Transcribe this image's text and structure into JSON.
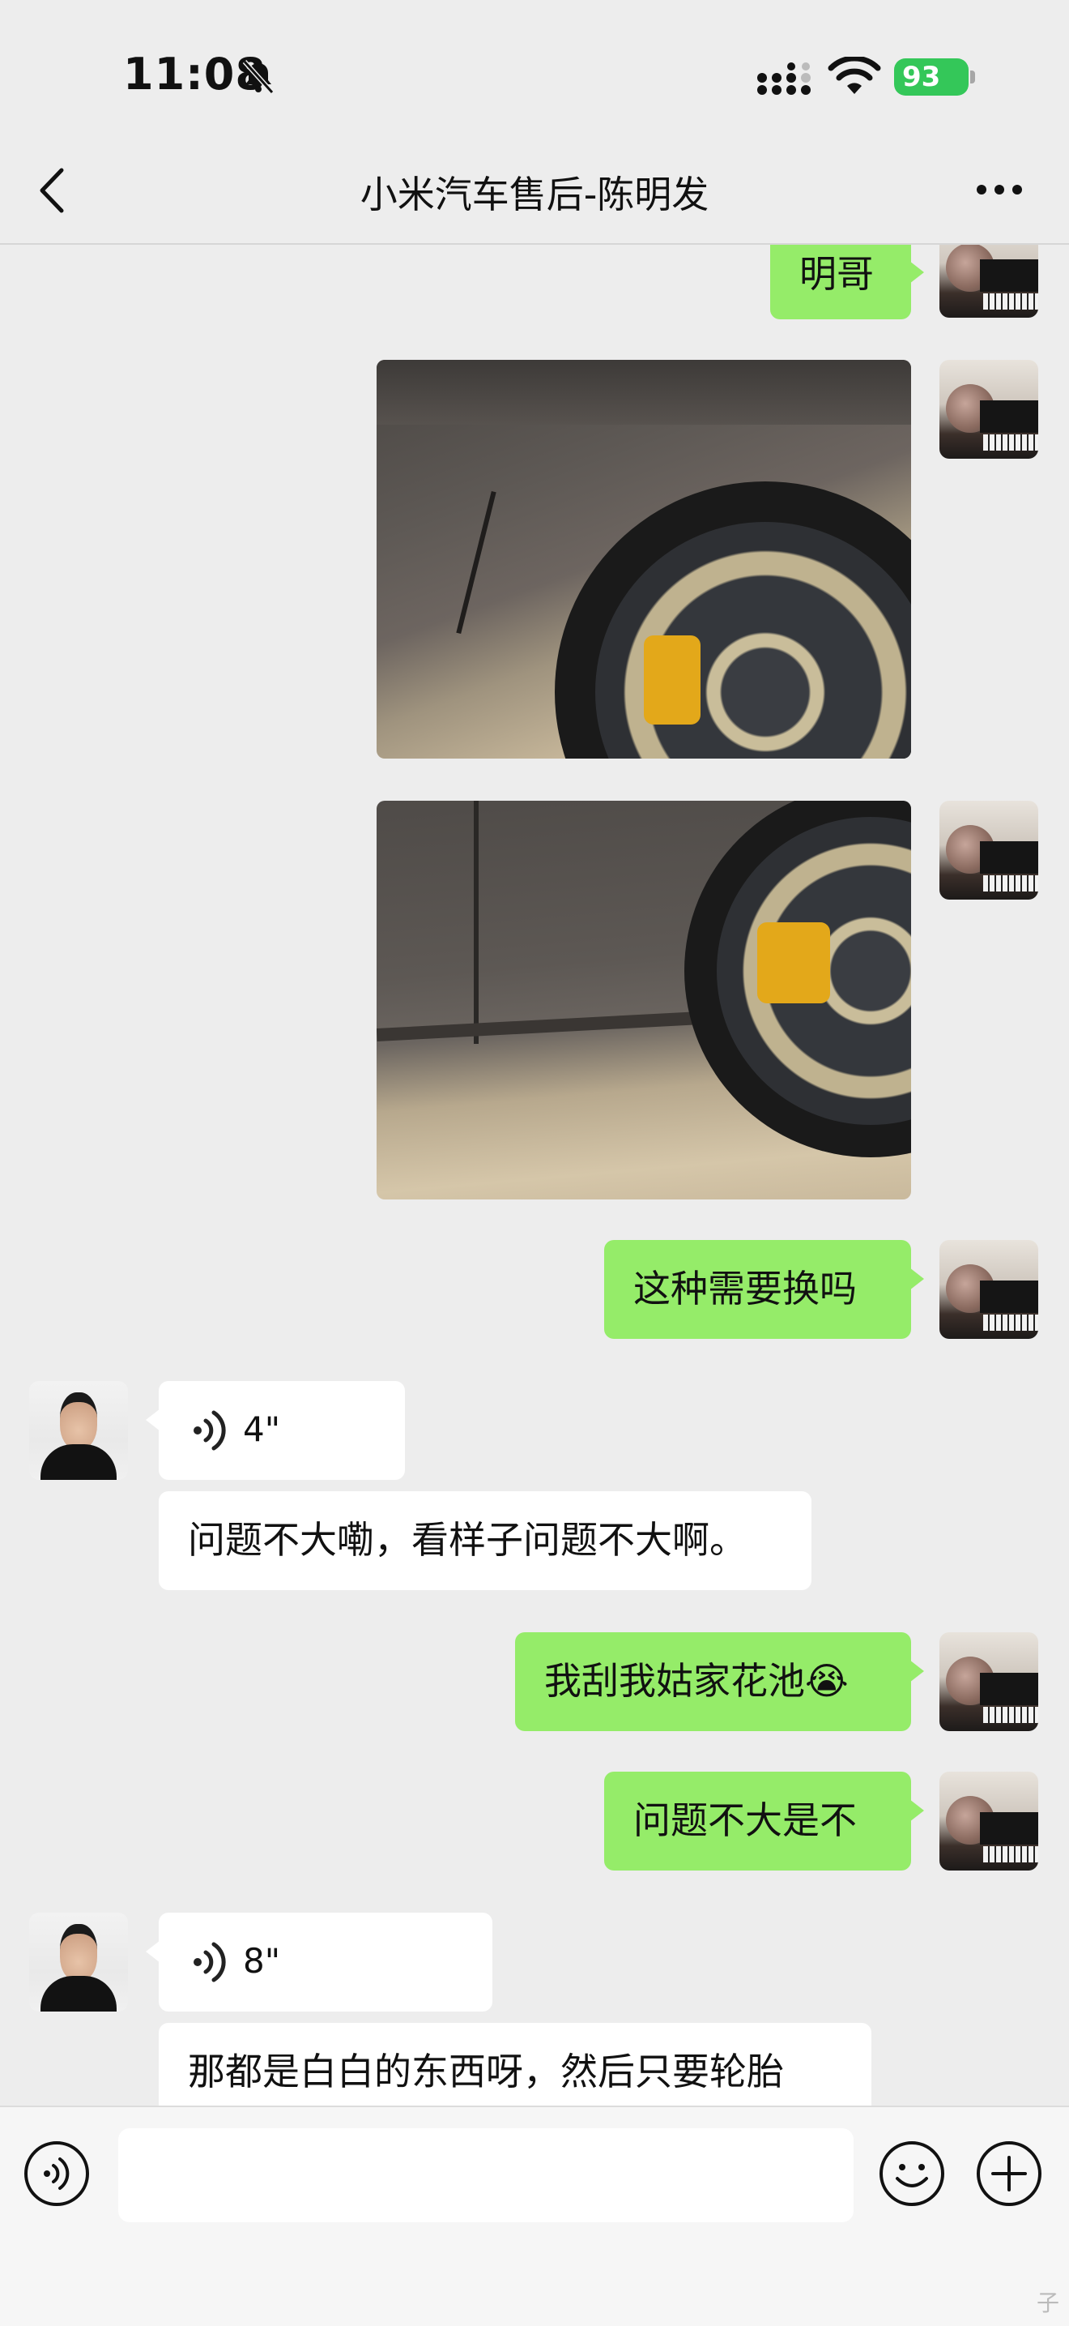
{
  "status_bar": {
    "time": "11:08",
    "battery": "93"
  },
  "nav": {
    "title": "小米汽车售后-陈明发"
  },
  "messages": [
    {
      "type": "text",
      "side": "mine",
      "text": "明哥"
    },
    {
      "type": "image",
      "side": "mine",
      "content": "car rear wheel with scrape"
    },
    {
      "type": "image",
      "side": "mine",
      "content": "car side panel scratch"
    },
    {
      "type": "text",
      "side": "mine",
      "text": "这种需要换吗"
    },
    {
      "type": "voice",
      "side": "other",
      "duration": "4\""
    },
    {
      "type": "text",
      "side": "other",
      "text": "问题不大嘞，看样子问题不大啊。"
    },
    {
      "type": "text",
      "side": "mine",
      "text": "我刮我姑家花池😭"
    },
    {
      "type": "text",
      "side": "mine",
      "text": "问题不大是不"
    },
    {
      "type": "voice",
      "side": "other",
      "duration": "8\""
    },
    {
      "type": "text",
      "side": "other",
      "text": "那都是白白的东西呀，然后只要轮胎"
    }
  ],
  "input": {
    "placeholder": ""
  },
  "watermark": "子",
  "colors": {
    "bubble_mine": "#95ec69",
    "bubble_other": "#ffffff",
    "background": "#ededed"
  }
}
